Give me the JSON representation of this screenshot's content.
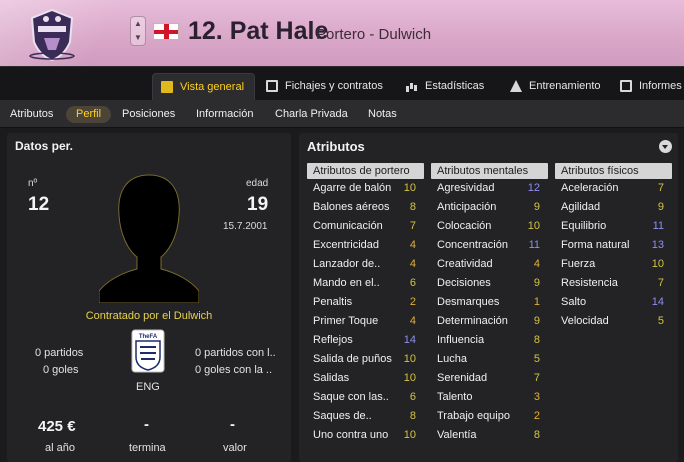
{
  "header": {
    "player_name": "12. Pat Hale",
    "subtitle": "Portero - Dulwich"
  },
  "tabs": [
    {
      "label": "Vista general",
      "icon": "overview-icon",
      "active": true
    },
    {
      "label": "Fichajes y contratos",
      "icon": "contract-doc-icon",
      "active": false
    },
    {
      "label": "Estadísticas",
      "icon": "stats-bars-icon",
      "active": false
    },
    {
      "label": "Entrenamiento",
      "icon": "training-cone-icon",
      "active": false
    },
    {
      "label": "Informes",
      "icon": "report-icon",
      "active": false
    }
  ],
  "subnav": [
    "Atributos",
    "Perfil",
    "Posiciones",
    "Información",
    "Charla Privada",
    "Notas"
  ],
  "subnav_active": "Perfil",
  "personal": {
    "title": "Datos per.",
    "number_label": "nº",
    "number": "12",
    "age_label": "edad",
    "age": "19",
    "dob": "15.7.2001",
    "contract": "Contratado por el Dulwich",
    "nation": "ENG",
    "badge_text": "TheFA",
    "left_stats": [
      "0 partidos",
      "0 goles"
    ],
    "right_stats": [
      "0 partidos con l..",
      "0 goles con la .."
    ],
    "wage": "425 €",
    "wage_label": "al año",
    "expires": "-",
    "expires_label": "termina",
    "value": "-",
    "value_label": "valor"
  },
  "attributes": {
    "title": "Atributos",
    "columns": [
      {
        "header": "Atributos de portero",
        "rows": [
          {
            "name": "Agarre de balón",
            "value": 10
          },
          {
            "name": "Balones aéreos",
            "value": 8
          },
          {
            "name": "Comunicación",
            "value": 7
          },
          {
            "name": "Excentricidad",
            "value": 4
          },
          {
            "name": "Lanzador de..",
            "value": 4
          },
          {
            "name": "Mando en el..",
            "value": 6
          },
          {
            "name": "Penaltis",
            "value": 2
          },
          {
            "name": "Primer Toque",
            "value": 4
          },
          {
            "name": "Reflejos",
            "value": 14
          },
          {
            "name": "Salida de puños",
            "value": 10
          },
          {
            "name": "Salidas",
            "value": 10
          },
          {
            "name": "Saque con las..",
            "value": 6
          },
          {
            "name": "Saques de..",
            "value": 8
          },
          {
            "name": "Uno contra uno",
            "value": 10
          }
        ]
      },
      {
        "header": "Atributos mentales",
        "rows": [
          {
            "name": "Agresividad",
            "value": 12
          },
          {
            "name": "Anticipación",
            "value": 9
          },
          {
            "name": "Colocación",
            "value": 10
          },
          {
            "name": "Concentración",
            "value": 11
          },
          {
            "name": "Creatividad",
            "value": 4
          },
          {
            "name": "Decisiones",
            "value": 9
          },
          {
            "name": "Desmarques",
            "value": 1
          },
          {
            "name": "Determinación",
            "value": 9
          },
          {
            "name": "Influencia",
            "value": 8
          },
          {
            "name": "Lucha",
            "value": 5
          },
          {
            "name": "Serenidad",
            "value": 7
          },
          {
            "name": "Talento",
            "value": 3
          },
          {
            "name": "Trabajo equipo",
            "value": 2
          },
          {
            "name": "Valentía",
            "value": 8
          }
        ]
      },
      {
        "header": "Atributos físicos",
        "rows": [
          {
            "name": "Aceleración",
            "value": 7
          },
          {
            "name": "Agilidad",
            "value": 9
          },
          {
            "name": "Equilibrio",
            "value": 11
          },
          {
            "name": "Forma natural",
            "value": 13
          },
          {
            "name": "Fuerza",
            "value": 10
          },
          {
            "name": "Resistencia",
            "value": 7
          },
          {
            "name": "Salto",
            "value": 14
          },
          {
            "name": "Velocidad",
            "value": 5
          }
        ]
      }
    ]
  },
  "colors": {
    "header_pink": "#d9a6c8",
    "accent_yellow": "#ffd21e",
    "value_low": "#d4c440",
    "value_high": "#8d8ff0"
  }
}
